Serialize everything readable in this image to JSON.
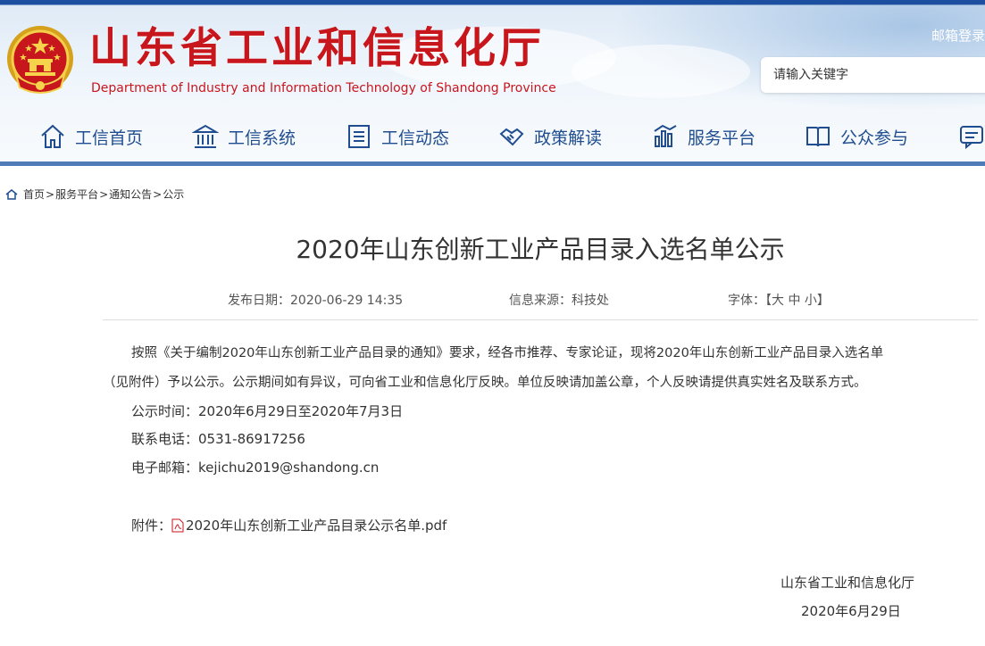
{
  "header": {
    "title": "山东省工业和信息化厅",
    "subtitle": "Department of Industry and Information Technology of Shandong Province",
    "login_link": "邮箱登录",
    "search": {
      "placeholder": "请输入关键字",
      "value": ""
    },
    "emblem_icon": "national-emblem-icon",
    "colors": {
      "title_red": "#c8161d",
      "nav_blue": "#1f4d8f"
    }
  },
  "nav": {
    "items": [
      {
        "label": "工信首页",
        "icon": "home-icon"
      },
      {
        "label": "工信系统",
        "icon": "building-icon"
      },
      {
        "label": "工信动态",
        "icon": "document-icon"
      },
      {
        "label": "政策解读",
        "icon": "handshake-icon"
      },
      {
        "label": "服务平台",
        "icon": "bar-chart-icon"
      },
      {
        "label": "公众参与",
        "icon": "book-icon"
      },
      {
        "label": "",
        "icon": "message-icon"
      }
    ]
  },
  "breadcrumb": {
    "items": [
      "首页",
      "服务平台",
      "通知公告",
      "公示"
    ],
    "separator": ">"
  },
  "article": {
    "title": "2020年山东创新工业产品目录入选名单公示",
    "meta": {
      "publish_date": "发布日期：2020-06-29 14:35",
      "source": "信息来源：科技处",
      "font_label": "字体：",
      "font_sizes": {
        "open": "【",
        "large": "大",
        "medium": "中",
        "small": "小",
        "close": "】"
      }
    },
    "body": {
      "para1_line1": "按照《关于编制2020年山东创新工业产品目录的通知》要求，经各市推荐、专家论证，现将2020年山东创新工业产品目录入选名单",
      "para1_line2": "（见附件）予以公示。公示期间如有异议，可向省工业和信息化厅反映。单位反映请加盖公章，个人反映请提供真实姓名及联系方式。",
      "period": "公示时间：2020年6月29日至2020年7月3日",
      "phone": "联系电话：0531-86917256",
      "email": "电子邮箱：kejichu2019@shandong.cn"
    },
    "attachment": {
      "label": "附件：",
      "file_name": "2020年山东创新工业产品目录公示名单.pdf",
      "icon": "pdf-icon"
    },
    "signature": {
      "org": "山东省工业和信息化厅",
      "date": "2020年6月29日"
    }
  }
}
